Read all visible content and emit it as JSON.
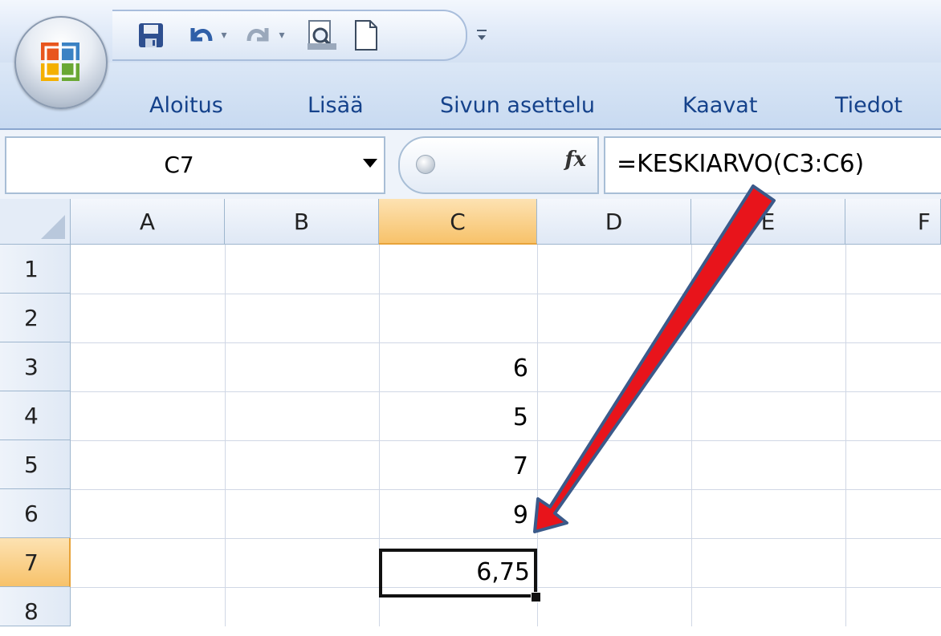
{
  "quick_access": {
    "save_icon": "save-icon",
    "undo_icon": "undo-icon",
    "redo_icon": "redo-icon",
    "print_preview_icon": "print-preview-icon",
    "new_icon": "new-document-icon",
    "customize_icon": "customize-icon"
  },
  "ribbon": {
    "tabs": [
      {
        "label": "Aloitus"
      },
      {
        "label": "Lisää"
      },
      {
        "label": "Sivun asettelu"
      },
      {
        "label": "Kaavat"
      },
      {
        "label": "Tiedot"
      }
    ]
  },
  "formula_bar": {
    "name_box": "C7",
    "fx_label": "fx",
    "formula": "=KESKIARVO(C3:C6)"
  },
  "sheet": {
    "columns": [
      "A",
      "B",
      "C",
      "D",
      "E",
      "F"
    ],
    "rows": [
      "1",
      "2",
      "3",
      "4",
      "5",
      "6",
      "7",
      "8"
    ],
    "selected_column": "C",
    "selected_row": "7",
    "cells": {
      "C3": "6",
      "C4": "5",
      "C5": "7",
      "C6": "9",
      "C7": "6,75"
    }
  },
  "colors": {
    "accent_selected_header": "#f7c26a",
    "arrow_fill": "#e8141b",
    "arrow_outline": "#3b5a8a",
    "tab_text": "#15428b"
  }
}
